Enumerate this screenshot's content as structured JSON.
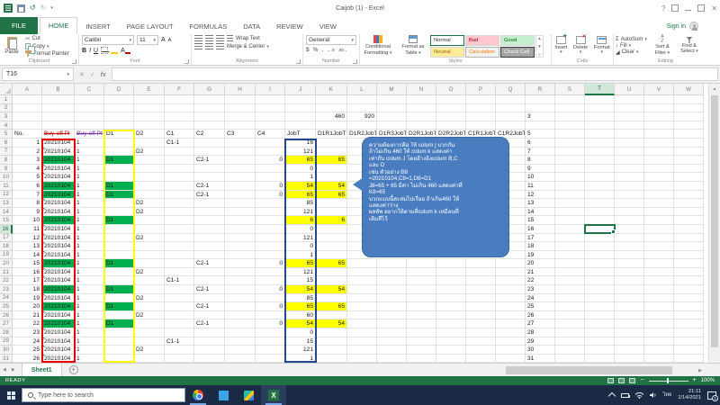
{
  "window": {
    "title": "Caijob (1) - Excel",
    "sign_in": "Sign in",
    "help": "?"
  },
  "icons": {
    "dropdown": "▾",
    "scissors": "✂",
    "undo": "↺",
    "redo": "↻",
    "close": "✕",
    "check": "✓",
    "up_arrow": "▲",
    "down_arrow": "▼",
    "left_arrow": "◀",
    "right_arrow": "▶",
    "plus": "+",
    "minus": "−",
    "sigma": "Σ",
    "fill_arrow": "↓",
    "clear_glyph": "◢",
    "gallery_more": "≡"
  },
  "ribbon": {
    "tabs": [
      "FILE",
      "HOME",
      "INSERT",
      "PAGE LAYOUT",
      "FORMULAS",
      "DATA",
      "REVIEW",
      "VIEW"
    ],
    "active_tab": "HOME",
    "clipboard": {
      "label": "Clipboard",
      "paste": "Paste",
      "cut": "Cut",
      "copy": "Copy",
      "format_painter": "Format Painter"
    },
    "font": {
      "label": "Font",
      "family": "Calibri",
      "size": "11",
      "bold": "B",
      "italic": "I",
      "underline": "U",
      "grow": "A",
      "shrink": "A",
      "color_letter": "A"
    },
    "alignment": {
      "label": "Alignment",
      "wrap_text": "Wrap Text",
      "merge_center": "Merge & Center"
    },
    "number": {
      "label": "Number",
      "format": "General",
      "currency": "$",
      "percent": "%",
      "comma": ",",
      "inc_decimal": "←.0",
      "dec_decimal": ".00→"
    },
    "styles": {
      "label": "Styles",
      "conditional_line1": "Conditional",
      "conditional_line2": "Formatting",
      "format_table_line1": "Format as",
      "format_table_line2": "Table",
      "gallery": [
        "Normal",
        "Bad",
        "Good",
        "Neutral",
        "Calculation",
        "Check Cell"
      ]
    },
    "cells": {
      "label": "Cells",
      "insert": "Insert",
      "delete": "Delete",
      "format": "Format"
    },
    "editing": {
      "label": "Editing",
      "autosum": "AutoSum",
      "fill": "Fill",
      "clear": "Clear",
      "sort_line1": "Sort &",
      "sort_line2": "Filter",
      "find_line1": "Find &",
      "find_line2": "Select"
    }
  },
  "formula_bar": {
    "name_box": "T16",
    "fx": "fx",
    "formula": ""
  },
  "grid": {
    "columns": [
      "A",
      "B",
      "C",
      "D",
      "E",
      "F",
      "G",
      "H",
      "I",
      "J",
      "K",
      "L",
      "M",
      "N",
      "O",
      "P",
      "Q",
      "R",
      "S",
      "T",
      "U",
      "V",
      "W"
    ],
    "row_count": 31,
    "selection": {
      "cell": "T16",
      "column": "T",
      "row": 16
    },
    "rows": [
      {
        "r": 3,
        "k": "460",
        "l": "920"
      },
      {
        "r": 5,
        "header": true,
        "a": "No.",
        "b": "Buy-off Pl",
        "c": "Buy-off Pt",
        "d": "D1",
        "e": "D2",
        "f": "C1",
        "g": "C2",
        "h": "C3",
        "i": "C4",
        "j": "JobT",
        "k": "D1R1JobT",
        "l": "D1R2JobT",
        "m": "D1R3JobT",
        "n": "D2R1JobT",
        "o": "D2R2JobT",
        "p": "C1R1JobT",
        "q": "C1R2JobT"
      },
      {
        "r": 6,
        "a": "1",
        "b": "20210104",
        "c": "1",
        "f": "C1-1",
        "j": "16"
      },
      {
        "r": 7,
        "a": "2",
        "b": "20210104",
        "c": "1",
        "e": "D2",
        "j": "121"
      },
      {
        "r": 8,
        "a": "3",
        "b": "20210104",
        "c": "1",
        "d": "D1",
        "g": "C2-1",
        "i": "0",
        "j": "65",
        "k": "65",
        "green": true,
        "yellow": true
      },
      {
        "r": 9,
        "a": "4",
        "b": "20210104",
        "c": "1",
        "j": "0"
      },
      {
        "r": 10,
        "a": "5",
        "b": "20210104",
        "c": "1",
        "j": "1"
      },
      {
        "r": 11,
        "a": "6",
        "b": "20210104",
        "c": "1",
        "d": "D1",
        "g": "C2-1",
        "i": "0",
        "j": "54",
        "k": "54",
        "green": true,
        "yellow": true
      },
      {
        "r": 12,
        "a": "7",
        "b": "20210104",
        "c": "1",
        "d": "D1",
        "g": "C2-1",
        "i": "0",
        "j": "65",
        "k": "65",
        "green": true,
        "yellow": true
      },
      {
        "r": 13,
        "a": "8",
        "b": "20210104",
        "c": "1",
        "e": "D2",
        "j": "85"
      },
      {
        "r": 14,
        "a": "9",
        "b": "20210104",
        "c": "1",
        "e": "D2",
        "j": "121"
      },
      {
        "r": 15,
        "a": "10",
        "b": "20210104",
        "c": "1",
        "d": "D1",
        "j": "6",
        "k": "6",
        "green": true,
        "yellow": true
      },
      {
        "r": 16,
        "a": "11",
        "b": "20210104",
        "c": "1",
        "j": "0"
      },
      {
        "r": 17,
        "a": "12",
        "b": "20210104",
        "c": "1",
        "e": "D2",
        "j": "121"
      },
      {
        "r": 18,
        "a": "13",
        "b": "20210104",
        "c": "1",
        "j": "0"
      },
      {
        "r": 19,
        "a": "14",
        "b": "20210104",
        "c": "1",
        "j": "1"
      },
      {
        "r": 20,
        "a": "15",
        "b": "20210104",
        "c": "1",
        "d": "D1",
        "g": "C2-1",
        "i": "0",
        "j": "65",
        "k": "65",
        "green": true,
        "yellow": true
      },
      {
        "r": 21,
        "a": "16",
        "b": "20210104",
        "c": "1",
        "e": "D2",
        "j": "121"
      },
      {
        "r": 22,
        "a": "17",
        "b": "20210104",
        "c": "1",
        "f": "C1-1",
        "j": "15"
      },
      {
        "r": 23,
        "a": "18",
        "b": "20210104",
        "c": "1",
        "d": "D1",
        "g": "C2-1",
        "i": "0",
        "j": "54",
        "k": "54",
        "green": true,
        "yellow": true
      },
      {
        "r": 24,
        "a": "19",
        "b": "20210104",
        "c": "1",
        "e": "D2",
        "j": "85"
      },
      {
        "r": 25,
        "a": "20",
        "b": "20210104",
        "c": "1",
        "d": "D1",
        "g": "C2-1",
        "i": "0",
        "j": "65",
        "k": "65",
        "green": true,
        "yellow": true
      },
      {
        "r": 26,
        "a": "21",
        "b": "20210104",
        "c": "1",
        "e": "D2",
        "j": "60"
      },
      {
        "r": 27,
        "a": "22",
        "b": "20210104",
        "c": "1",
        "d": "D1",
        "g": "C2-1",
        "i": "0",
        "j": "54",
        "k": "54",
        "green": true,
        "yellow": true
      },
      {
        "r": 28,
        "a": "23",
        "b": "20210104",
        "c": "1",
        "j": "0"
      },
      {
        "r": 29,
        "a": "24",
        "b": "20210104",
        "c": "1",
        "f": "C1-1",
        "j": "15"
      },
      {
        "r": 30,
        "a": "25",
        "b": "20210104",
        "c": "1",
        "e": "D2",
        "j": "121"
      },
      {
        "r": 31,
        "a": "26",
        "b": "20210104",
        "c": "1",
        "j": "1"
      }
    ]
  },
  "callout": {
    "text": "ความต้องการคือ ให้ colum j บวกกัน\nถ้าไม่เกิน 460 ให้ colum k แสดงค่า\nเท่ากับ colum J โดยอ้างอิงcolum B,C\nและ D\nเช่น ตัวอย่าง B8\n=20210104,C8=1,D8=D1\nJ8=65 + 65 มีค่า ไม่เกิน 460 แสดงค่าที่\nK8=65\nบวกแบบนี้สะสมไปเรื่อย ถ้าเกิน460 ให้\nแสดงค่าว่าง\nผลลัพ อยากให้ตามที่colum k เหมือนที่\nเติมสีไว้"
  },
  "sheet_bar": {
    "tab": "Sheet1"
  },
  "status_bar": {
    "mode": "READY",
    "zoom": "100%"
  },
  "taskbar": {
    "search_placeholder": "Type here to search",
    "language": "ไทย",
    "time": "21:11",
    "date": "1/14/2021",
    "notification_badge": "1",
    "excel_glyph": "X"
  },
  "colors": {
    "brand_green": "#217346",
    "cell_green": "#00B050",
    "cell_yellow": "#FFFF00",
    "box_red": "#E60000",
    "box_yellow": "#FFFF00",
    "box_blue": "#24478F",
    "callout_blue": "#4A7DC0",
    "bad_bg": "#FFC7CE",
    "good_bg": "#C6EFCE",
    "neutral_bg": "#FFEB9C",
    "check_bg": "#A5A5A5"
  }
}
